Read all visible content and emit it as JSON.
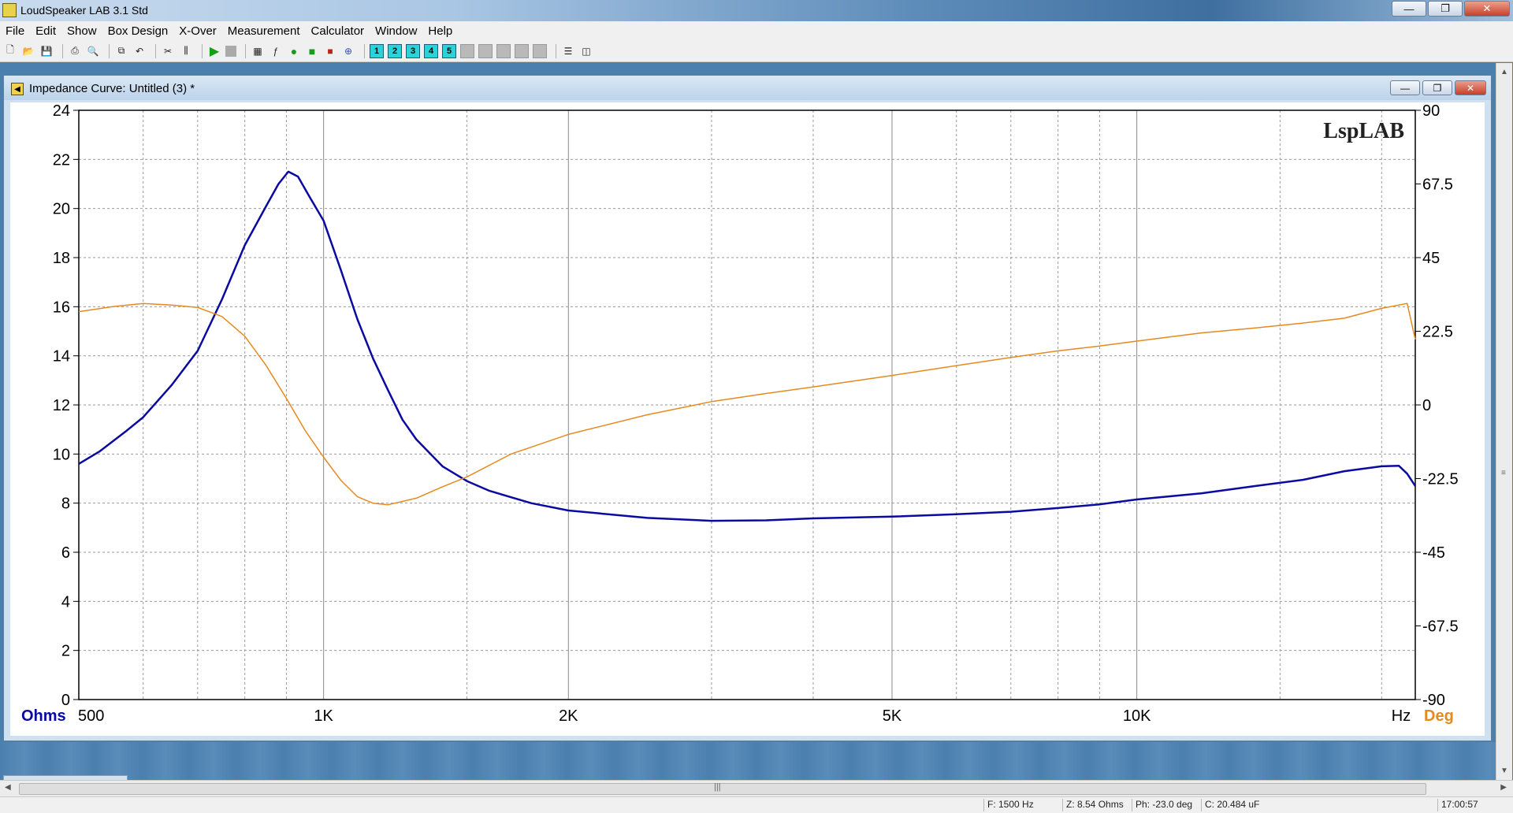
{
  "app": {
    "title": "LoudSpeaker LAB 3.1 Std",
    "controls": {
      "minimize": "—",
      "maximize": "❐",
      "close": "✕"
    }
  },
  "menu": [
    "File",
    "Edit",
    "Show",
    "Box Design",
    "X-Over",
    "Measurement",
    "Calculator",
    "Window",
    "Help"
  ],
  "toolbar": {
    "groups": [
      [
        "new-file-icon",
        "open-folder-icon",
        "save-icon"
      ],
      [
        "print-icon",
        "print-preview-icon"
      ],
      [
        "copy-icon",
        "undo-icon"
      ],
      [
        "tools-icon",
        "sliders-icon",
        "play-icon",
        "stop-icon",
        "chart-rb-icon",
        "fg-icon",
        "green-dot-icon",
        "green-box-icon",
        "red-box-icon",
        "crosshair-icon"
      ]
    ],
    "numbers": [
      "1",
      "2",
      "3",
      "4",
      "5"
    ]
  },
  "window": {
    "title": "Impedance Curve: Untitled (3) *",
    "controls": {
      "minimize": "—",
      "restore": "❐",
      "close": "✕"
    }
  },
  "chart_data": {
    "type": "line",
    "watermark": "LspLAB",
    "x_scale": "log",
    "xlim": [
      500,
      22000
    ],
    "x_ticks": [
      {
        "value": 500,
        "label": "500"
      },
      {
        "value": 1000,
        "label": "1K"
      },
      {
        "value": 2000,
        "label": "2K"
      },
      {
        "value": 5000,
        "label": "5K"
      },
      {
        "value": 10000,
        "label": "10K"
      }
    ],
    "x_minor_lines": [
      600,
      700,
      800,
      900,
      1500,
      3000,
      4000,
      6000,
      7000,
      8000,
      9000,
      15000,
      20000
    ],
    "x_unit": "Hz",
    "y_left": {
      "unit": "Ohms",
      "lim": [
        0,
        24
      ],
      "ticks": [
        "0",
        "2",
        "4",
        "6",
        "8",
        "10",
        "12",
        "14",
        "16",
        "18",
        "20",
        "22",
        "24"
      ]
    },
    "y_right": {
      "unit": "Deg",
      "lim": [
        -90,
        90
      ],
      "ticks": [
        "-90",
        "-67.5",
        "-45",
        "-22.5",
        "0",
        "22.5",
        "45",
        "67.5",
        "90"
      ]
    },
    "grid": true,
    "series": [
      {
        "key": "impedance",
        "axis": "left",
        "color": "#0a0aa0",
        "points": [
          [
            500,
            9.6
          ],
          [
            530,
            10.1
          ],
          [
            570,
            10.9
          ],
          [
            600,
            11.5
          ],
          [
            650,
            12.8
          ],
          [
            700,
            14.2
          ],
          [
            750,
            16.3
          ],
          [
            800,
            18.5
          ],
          [
            850,
            20.1
          ],
          [
            880,
            21.0
          ],
          [
            905,
            21.5
          ],
          [
            930,
            21.3
          ],
          [
            960,
            20.5
          ],
          [
            1000,
            19.5
          ],
          [
            1050,
            17.5
          ],
          [
            1100,
            15.5
          ],
          [
            1150,
            13.9
          ],
          [
            1200,
            12.6
          ],
          [
            1250,
            11.4
          ],
          [
            1300,
            10.6
          ],
          [
            1400,
            9.5
          ],
          [
            1500,
            8.9
          ],
          [
            1600,
            8.5
          ],
          [
            1800,
            8.0
          ],
          [
            2000,
            7.7
          ],
          [
            2500,
            7.4
          ],
          [
            3000,
            7.28
          ],
          [
            3500,
            7.3
          ],
          [
            4000,
            7.38
          ],
          [
            5000,
            7.45
          ],
          [
            6000,
            7.55
          ],
          [
            7000,
            7.65
          ],
          [
            8000,
            7.8
          ],
          [
            9000,
            7.95
          ],
          [
            10000,
            8.15
          ],
          [
            12000,
            8.4
          ],
          [
            14000,
            8.7
          ],
          [
            16000,
            8.95
          ],
          [
            18000,
            9.3
          ],
          [
            20000,
            9.5
          ],
          [
            21000,
            9.52
          ],
          [
            21500,
            9.2
          ],
          [
            22000,
            8.7
          ]
        ]
      },
      {
        "key": "phase",
        "axis": "right",
        "color": "#e58a1f",
        "points": [
          [
            500,
            28.5
          ],
          [
            550,
            30
          ],
          [
            600,
            31
          ],
          [
            650,
            30.5
          ],
          [
            700,
            29.8
          ],
          [
            750,
            27
          ],
          [
            800,
            21
          ],
          [
            850,
            12
          ],
          [
            900,
            2
          ],
          [
            950,
            -8
          ],
          [
            1000,
            -16
          ],
          [
            1050,
            -23
          ],
          [
            1100,
            -28
          ],
          [
            1150,
            -30
          ],
          [
            1200,
            -30.5
          ],
          [
            1300,
            -28.5
          ],
          [
            1400,
            -25
          ],
          [
            1500,
            -22
          ],
          [
            1700,
            -15
          ],
          [
            2000,
            -9
          ],
          [
            2500,
            -3
          ],
          [
            3000,
            1
          ],
          [
            3500,
            3.5
          ],
          [
            4000,
            5.5
          ],
          [
            5000,
            9
          ],
          [
            6000,
            12
          ],
          [
            7000,
            14.5
          ],
          [
            8000,
            16.5
          ],
          [
            9000,
            18
          ],
          [
            10000,
            19.5
          ],
          [
            12000,
            22
          ],
          [
            14000,
            23.5
          ],
          [
            16000,
            25
          ],
          [
            18000,
            26.5
          ],
          [
            20000,
            29.5
          ],
          [
            21500,
            31
          ],
          [
            22000,
            20
          ]
        ]
      }
    ]
  },
  "status": [
    "F: 1500 Hz",
    "Z: 8.54 Ohms",
    "Ph: -23.0 deg",
    "C: 20.484 uF",
    "17:00:57"
  ]
}
